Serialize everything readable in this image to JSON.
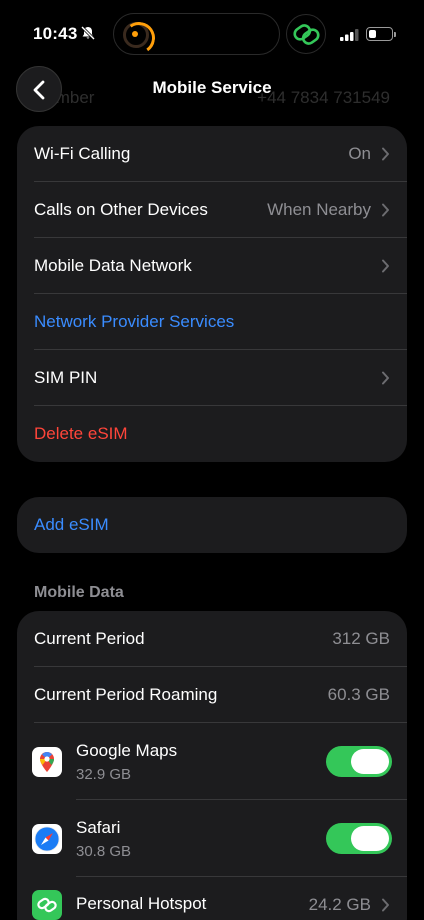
{
  "status_bar": {
    "time": "10:43",
    "battery_level": 0.35
  },
  "nav": {
    "title": "Mobile Service",
    "back_icon": "chevron-left-icon"
  },
  "scrolled_row": {
    "label": "Number",
    "value": "+44 7834 731549"
  },
  "settings_group": {
    "items": [
      {
        "label": "Wi-Fi Calling",
        "value": "On"
      },
      {
        "label": "Calls on Other Devices",
        "value": "When Nearby"
      },
      {
        "label": "Mobile Data Network",
        "value": ""
      },
      {
        "label": "Network Provider Services"
      },
      {
        "label": "SIM PIN",
        "value": ""
      },
      {
        "label": "Delete eSIM"
      }
    ]
  },
  "add_esim": {
    "label": "Add eSIM"
  },
  "mobile_data": {
    "header": "Mobile Data",
    "current_period": {
      "label": "Current Period",
      "value": "312 GB"
    },
    "current_period_roaming": {
      "label": "Current Period Roaming",
      "value": "60.3 GB"
    },
    "apps": [
      {
        "name": "Google Maps",
        "size": "32.9 GB",
        "enabled": true,
        "icon": "google-maps-icon"
      },
      {
        "name": "Safari",
        "size": "30.8 GB",
        "enabled": true,
        "icon": "safari-icon"
      }
    ],
    "personal_hotspot": {
      "name": "Personal Hotspot",
      "value": "24.2 GB",
      "icon": "personal-hotspot-icon"
    }
  },
  "colors": {
    "background": "#000000",
    "group_background": "#1c1c1e",
    "link_blue": "#3a8cff",
    "destructive_red": "#ff453a",
    "toggle_green": "#34c759",
    "secondary_text": "#8e8e93"
  }
}
